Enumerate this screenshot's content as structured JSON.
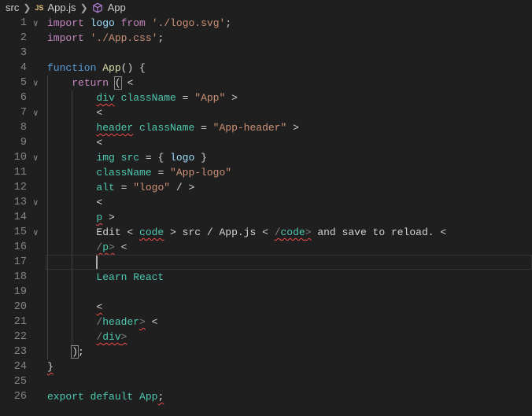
{
  "breadcrumb": {
    "folder": "src",
    "file_badge": "JS",
    "file": "App.js",
    "symbol": "App"
  },
  "editor": {
    "current_line": 17,
    "lines": [
      {
        "n": "1",
        "fold": true,
        "indent": 0,
        "tokens": [
          [
            "import",
            "kw"
          ],
          [
            " ",
            "pun"
          ],
          [
            "logo",
            "var"
          ],
          [
            " ",
            "pun"
          ],
          [
            "from",
            "kw"
          ],
          [
            " ",
            "pun"
          ],
          [
            "'./logo.svg'",
            "str"
          ],
          [
            ";",
            "pun"
          ]
        ]
      },
      {
        "n": "2",
        "indent": 0,
        "tokens": [
          [
            "import",
            "kw"
          ],
          [
            " ",
            "pun"
          ],
          [
            "'./App.css'",
            "str"
          ],
          [
            ";",
            "pun"
          ]
        ]
      },
      {
        "n": "3",
        "indent": 0,
        "tokens": []
      },
      {
        "n": "4",
        "indent": 0,
        "tokens": [
          [
            "function",
            "fn"
          ],
          [
            " ",
            "pun"
          ],
          [
            "App",
            "fname"
          ],
          [
            "() {",
            "pun"
          ]
        ]
      },
      {
        "n": "5",
        "fold": true,
        "indent": 1,
        "tokens": [
          [
            "    ",
            "pun"
          ],
          [
            "return",
            "kw"
          ],
          [
            " ",
            "pun"
          ],
          [
            "(",
            "pun bm"
          ],
          [
            " <",
            "pun"
          ]
        ]
      },
      {
        "n": "6",
        "indent": 2,
        "tokens": [
          [
            "        ",
            "pun"
          ],
          [
            "div",
            "tag sq"
          ],
          [
            " ",
            "pun"
          ],
          [
            "className",
            "tag"
          ],
          [
            " = ",
            "pun"
          ],
          [
            "\"App\"",
            "str"
          ],
          [
            " >",
            "pun"
          ]
        ]
      },
      {
        "n": "7",
        "fold": true,
        "indent": 2,
        "tokens": [
          [
            "        ",
            "pun"
          ],
          [
            "<",
            "pun"
          ]
        ]
      },
      {
        "n": "8",
        "indent": 2,
        "tokens": [
          [
            "        ",
            "pun"
          ],
          [
            "header",
            "tag sq"
          ],
          [
            " ",
            "pun"
          ],
          [
            "className",
            "tag"
          ],
          [
            " = ",
            "pun"
          ],
          [
            "\"App-header\"",
            "str"
          ],
          [
            " >",
            "pun"
          ]
        ]
      },
      {
        "n": "9",
        "indent": 2,
        "tokens": [
          [
            "        ",
            "pun"
          ],
          [
            "<",
            "pun"
          ]
        ]
      },
      {
        "n": "10",
        "fold": true,
        "indent": 2,
        "tokens": [
          [
            "        ",
            "pun"
          ],
          [
            "img",
            "tag"
          ],
          [
            " ",
            "pun"
          ],
          [
            "src",
            "tag"
          ],
          [
            " = { ",
            "pun"
          ],
          [
            "logo",
            "var"
          ],
          [
            " }",
            "pun"
          ]
        ]
      },
      {
        "n": "11",
        "indent": 2,
        "tokens": [
          [
            "        ",
            "pun"
          ],
          [
            "className",
            "tag"
          ],
          [
            " = ",
            "pun"
          ],
          [
            "\"App-logo\"",
            "str"
          ]
        ]
      },
      {
        "n": "12",
        "indent": 2,
        "tokens": [
          [
            "        ",
            "pun"
          ],
          [
            "alt",
            "tag"
          ],
          [
            " = ",
            "pun"
          ],
          [
            "\"logo\"",
            "str"
          ],
          [
            " / >",
            "pun"
          ]
        ]
      },
      {
        "n": "13",
        "fold": true,
        "indent": 2,
        "tokens": [
          [
            "        ",
            "pun"
          ],
          [
            "<",
            "pun"
          ]
        ]
      },
      {
        "n": "14",
        "indent": 2,
        "tokens": [
          [
            "        ",
            "pun"
          ],
          [
            "p",
            "tag sq"
          ],
          [
            " >",
            "pun"
          ]
        ]
      },
      {
        "n": "15",
        "fold": true,
        "indent": 2,
        "tokens": [
          [
            "        ",
            "pun"
          ],
          [
            "Edit < ",
            "txt"
          ],
          [
            "code",
            "tag sq"
          ],
          [
            " > src / App.js < ",
            "txt"
          ],
          [
            "/",
            "sl sq"
          ],
          [
            "code",
            "tag sq"
          ],
          [
            ">",
            "sl sq"
          ],
          [
            " and save to reload. <",
            "txt"
          ]
        ]
      },
      {
        "n": "16",
        "indent": 2,
        "tokens": [
          [
            "        ",
            "pun"
          ],
          [
            "/",
            "sl sq"
          ],
          [
            "p",
            "tag sq"
          ],
          [
            ">",
            "sl sq"
          ],
          [
            " <",
            "pun"
          ]
        ]
      },
      {
        "n": "17",
        "indent": 2,
        "cursor": true,
        "tokens": [
          [
            "        ",
            "pun"
          ]
        ]
      },
      {
        "n": "18",
        "indent": 2,
        "tokens": [
          [
            "        ",
            "pun"
          ],
          [
            "Learn React",
            "tag"
          ]
        ]
      },
      {
        "n": "19",
        "indent": 2,
        "tokens": []
      },
      {
        "n": "20",
        "indent": 2,
        "tokens": [
          [
            "        ",
            "pun"
          ],
          [
            "<",
            "pun sq"
          ]
        ]
      },
      {
        "n": "21",
        "indent": 2,
        "tokens": [
          [
            "        ",
            "pun"
          ],
          [
            "/",
            "sl"
          ],
          [
            "header",
            "tag"
          ],
          [
            ">",
            "sl sq"
          ],
          [
            " <",
            "pun"
          ]
        ]
      },
      {
        "n": "22",
        "indent": 2,
        "tokens": [
          [
            "        ",
            "pun"
          ],
          [
            "/",
            "sl sq"
          ],
          [
            "div",
            "tag sq"
          ],
          [
            ">",
            "sl sq"
          ]
        ]
      },
      {
        "n": "23",
        "indent": 1,
        "tokens": [
          [
            "    ",
            "pun"
          ],
          [
            ")",
            "pun bm"
          ],
          [
            ";",
            "pun"
          ]
        ]
      },
      {
        "n": "24",
        "indent": 0,
        "tokens": [
          [
            "}",
            "pun sq"
          ]
        ]
      },
      {
        "n": "25",
        "indent": 0,
        "tokens": []
      },
      {
        "n": "26",
        "indent": 0,
        "tokens": [
          [
            "export",
            "tag"
          ],
          [
            " ",
            "pun"
          ],
          [
            "default",
            "tag"
          ],
          [
            " ",
            "pun"
          ],
          [
            "App",
            "tag"
          ],
          [
            ";",
            "pun sq"
          ]
        ]
      }
    ]
  }
}
